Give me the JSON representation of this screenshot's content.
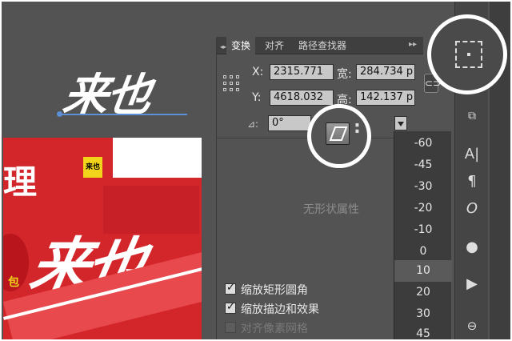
{
  "artwork": {
    "logo_text": "来也",
    "poster_char": "理",
    "poster_badge": "来也",
    "poster_big_text": "来也",
    "poster_side_text": "包"
  },
  "panel": {
    "tabs": [
      "变换",
      "对齐",
      "路径查找器"
    ],
    "active_tab": "变换",
    "x_label": "X:",
    "x_value": "2315.771",
    "y_label": "Y:",
    "y_value": "4618.032",
    "w_label": "宽:",
    "w_value": "284.734 p",
    "h_label": "高:",
    "h_value": "142.137 p",
    "angle_value": "0°",
    "empty_message": "无形状属性",
    "checkboxes": [
      {
        "label": "缩放矩形圆角",
        "checked": true,
        "enabled": true
      },
      {
        "label": "缩放描边和效果",
        "checked": true,
        "enabled": true
      },
      {
        "label": "对齐像素网格",
        "checked": false,
        "enabled": false
      }
    ]
  },
  "shear_dropdown": {
    "options": [
      "-60",
      "-45",
      "-30",
      "-20",
      "-10",
      "0",
      "10",
      "20",
      "30",
      "45"
    ],
    "selected": "10"
  },
  "toolstrip": {
    "tools": [
      "align-panel",
      "pathfinder",
      "character",
      "paragraph",
      "opentype",
      "appearance",
      "play",
      "links"
    ]
  }
}
